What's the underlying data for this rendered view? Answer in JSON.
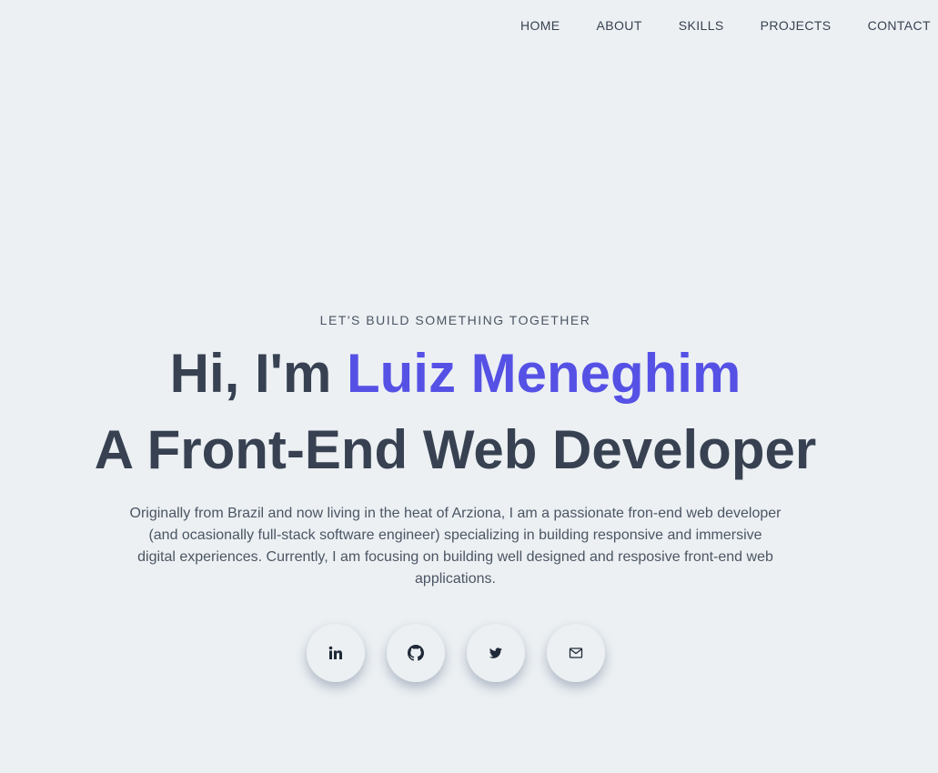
{
  "nav": {
    "items": [
      "HOME",
      "ABOUT",
      "SKILLS",
      "PROJECTS",
      "CONTACT"
    ]
  },
  "hero": {
    "tagline": "LET'S BUILD SOMETHING TOGETHER",
    "greeting": "Hi, I'm ",
    "name": "Luiz Meneghim",
    "title": "A Front-End Web Developer",
    "bio": "Originally from Brazil and now living in the heat of Arziona, I am a passionate fron-end web developer (and ocasionally full-stack software engineer) specializing in building responsive and immersive digital experiences. Currently, I am focusing on building well designed and resposive front-end web applications."
  },
  "socials": [
    {
      "icon": "linkedin-icon"
    },
    {
      "icon": "github-icon"
    },
    {
      "icon": "twitter-icon"
    },
    {
      "icon": "mail-icon"
    }
  ],
  "colors": {
    "background": "#ecf0f3",
    "accent": "#5651e5",
    "text": "#374151"
  }
}
